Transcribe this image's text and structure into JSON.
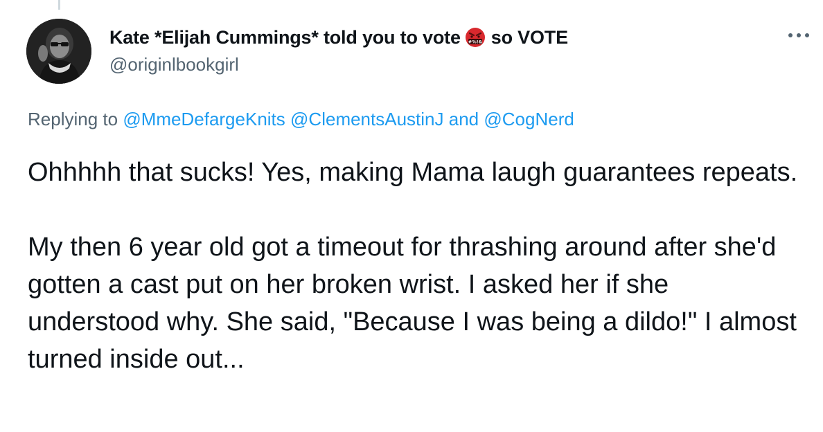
{
  "tweet": {
    "author": {
      "display_name": "Kate *Elijah Cummings* told you to vote",
      "display_name_suffix": "so VOTE",
      "emoji": "face-with-symbols-on-mouth",
      "handle": "@originlbookgirl"
    },
    "more_icon": "more-options-icon",
    "replying": {
      "prefix": "Replying to",
      "mention_1": "@MmeDefargeKnits",
      "mention_2": "@ClementsAustinJ",
      "connector": "and",
      "mention_3": "@CogNerd"
    },
    "paragraphs": [
      "Ohhhhh that sucks! Yes, making Mama laugh guarantees repeats.",
      "My then 6 year old got a timeout for thrashing around after she'd gotten a cast put on her broken wrist. I asked her if she understood why. She said, \"Because I was being a dildo!\" I almost turned inside out..."
    ]
  },
  "colors": {
    "text": "#0f1419",
    "secondary": "#536471",
    "link": "#1d9bf0",
    "emoji_red": "#d8282d"
  }
}
